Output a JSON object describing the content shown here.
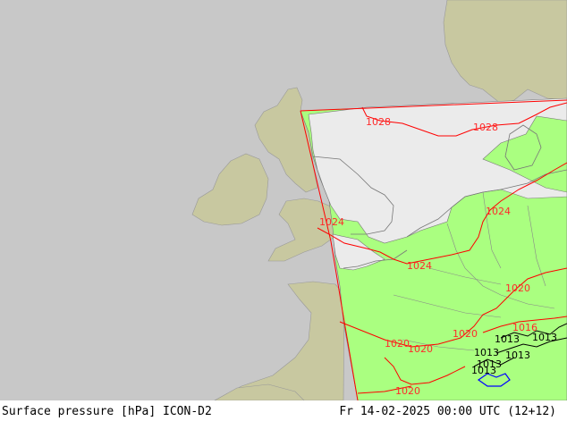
{
  "map": {
    "colors": {
      "sea": "#c8c8c8",
      "land_outside": "#c8c8a0",
      "land_domain": "#aaff80",
      "high_pressure_area": "#ebebeb",
      "isobar_red": "#ff0000",
      "isobar_black": "#000000",
      "isobar_blue": "#0000ff",
      "coastline": "#888888"
    },
    "isobar_labels": [
      "1028",
      "1028",
      "1024",
      "1024",
      "1024",
      "1020",
      "1016",
      "1013",
      "1013",
      "1020",
      "1020",
      "1020",
      "1013",
      "1013",
      "1013",
      "1020",
      "1013"
    ]
  },
  "footer": {
    "left_label": "Surface pressure [hPa] ICON-D2",
    "right_label": "Fr 14-02-2025 00:00 UTC (12+12)"
  }
}
